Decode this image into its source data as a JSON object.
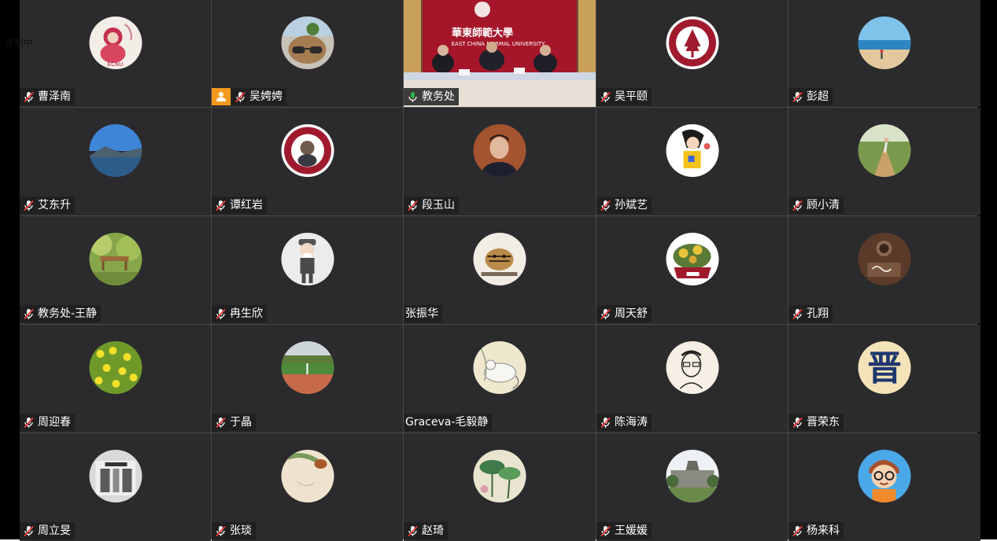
{
  "recording_label": "录制中",
  "colors": {
    "tile_bg": "#2b2b2d",
    "active_speaker": "#2fb24b",
    "muted_mic": "#e23a3a",
    "badge": "#f39a1e"
  },
  "participants": [
    {
      "name": "曹泽南",
      "mic": "muted",
      "avatar": "ecnu-girl-avatar"
    },
    {
      "name": "吴娉娉",
      "mic": "muted",
      "avatar": "sunglasses-dog-avatar",
      "badge": "person-icon"
    },
    {
      "name": "教务处",
      "mic": "speaking",
      "video": "meeting-room-video",
      "banner_cn": "華東師範大學",
      "banner_en": "EAST CHINA NORMAL UNIVERSITY"
    },
    {
      "name": "吴平颐",
      "mic": "muted",
      "avatar": "ecnu-logo-avatar"
    },
    {
      "name": "彭超",
      "mic": "muted",
      "avatar": "beach-avatar"
    },
    {
      "name": "艾东升",
      "mic": "muted",
      "avatar": "lake-mountain-avatar"
    },
    {
      "name": "谭红岩",
      "mic": "muted",
      "avatar": "ecnu-seal-photo-avatar"
    },
    {
      "name": "段玉山",
      "mic": "muted",
      "avatar": "man-portrait-avatar"
    },
    {
      "name": "孙斌艺",
      "mic": "muted",
      "avatar": "cartoon-girl-avatar"
    },
    {
      "name": "顾小清",
      "mic": "muted",
      "avatar": "runner-trail-avatar"
    },
    {
      "name": "教务处-王静",
      "mic": "muted",
      "avatar": "bench-garden-avatar"
    },
    {
      "name": "冉生欣",
      "mic": "muted",
      "avatar": "cartoon-boy-avatar"
    },
    {
      "name": "张振华",
      "mic": "none",
      "avatar": "tiger-painting-avatar"
    },
    {
      "name": "周天舒",
      "mic": "muted",
      "avatar": "succulent-cup-avatar"
    },
    {
      "name": "孔翔",
      "mic": "muted",
      "avatar": "coffee-art-avatar"
    },
    {
      "name": "周迎春",
      "mic": "muted",
      "avatar": "yellow-flowers-avatar"
    },
    {
      "name": "于晶",
      "mic": "muted",
      "avatar": "field-photo-avatar"
    },
    {
      "name": "Graceva-毛毅静",
      "mic": "none",
      "avatar": "mouse-painting-avatar"
    },
    {
      "name": "陈海涛",
      "mic": "muted",
      "avatar": "sketch-portrait-avatar"
    },
    {
      "name": "晋荣东",
      "mic": "muted",
      "avatar": "jin-character-avatar",
      "avatar_text": "晋"
    },
    {
      "name": "周立旻",
      "mic": "muted",
      "avatar": "building-door-avatar"
    },
    {
      "name": "张琰",
      "mic": "muted",
      "avatar": "leaf-sketch-avatar"
    },
    {
      "name": "赵琦",
      "mic": "muted",
      "avatar": "lotus-painting-avatar"
    },
    {
      "name": "王媛媛",
      "mic": "muted",
      "avatar": "campus-building-avatar"
    },
    {
      "name": "杨来科",
      "mic": "muted",
      "avatar": "cartoon-glasses-avatar"
    }
  ]
}
